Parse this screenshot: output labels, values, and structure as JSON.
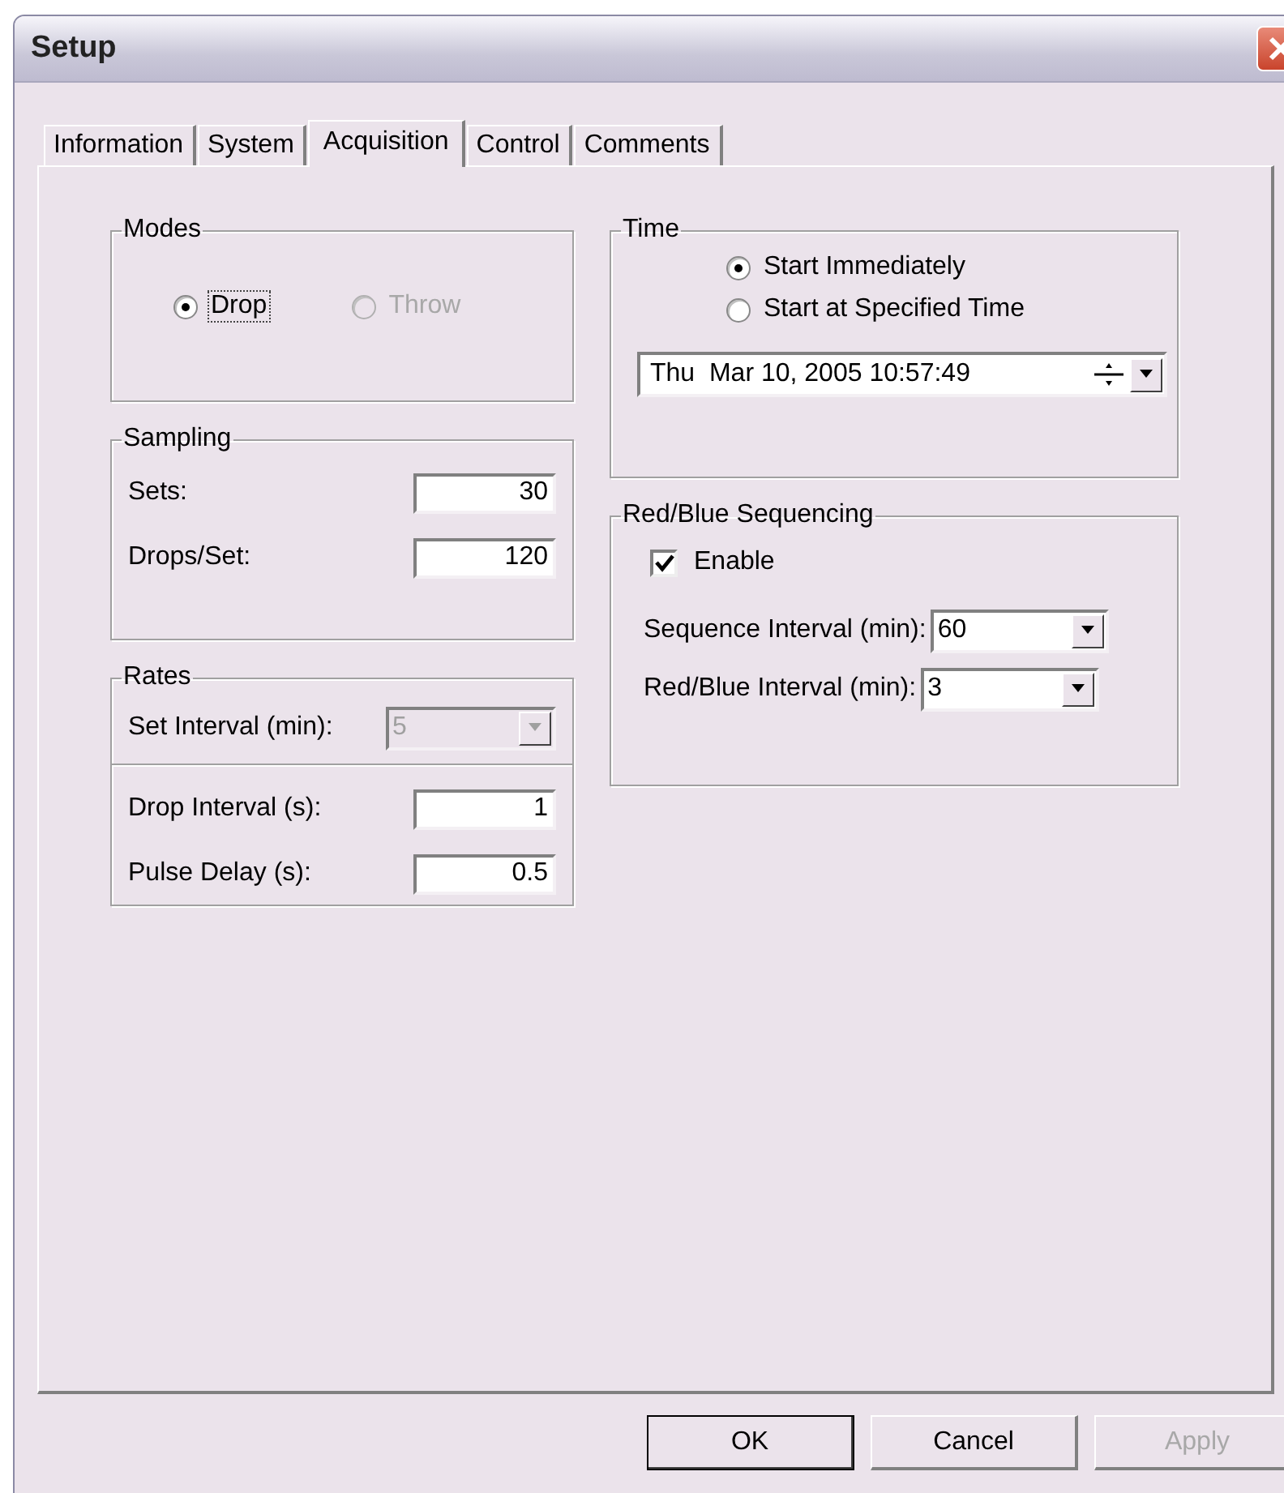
{
  "window": {
    "title": "Setup"
  },
  "tabs": [
    {
      "label": "Information",
      "selected": false
    },
    {
      "label": "System",
      "selected": false
    },
    {
      "label": "Acquisition",
      "selected": true
    },
    {
      "label": "Control",
      "selected": false
    },
    {
      "label": "Comments",
      "selected": false
    }
  ],
  "modes": {
    "title": "Modes",
    "options": [
      {
        "label": "Drop",
        "selected": true,
        "disabled": false,
        "focused": true
      },
      {
        "label": "Throw",
        "selected": false,
        "disabled": true,
        "focused": false
      }
    ]
  },
  "sampling": {
    "title": "Sampling",
    "fields": [
      {
        "label": "Sets:",
        "value": "30"
      },
      {
        "label": "Drops/Set:",
        "value": "120"
      }
    ]
  },
  "rates": {
    "title": "Rates",
    "set_interval": {
      "label": "Set Interval (min):",
      "value": "5",
      "disabled": true
    },
    "fields": [
      {
        "label": "Drop Interval (s):",
        "value": "1"
      },
      {
        "label": "Pulse Delay (s):",
        "value": "0.5"
      }
    ]
  },
  "time": {
    "title": "Time",
    "options": [
      {
        "label": "Start Immediately",
        "selected": true
      },
      {
        "label": "Start at Specified Time",
        "selected": false
      }
    ],
    "datetime": "Thu  Mar 10, 2005 10:57:49"
  },
  "sequencing": {
    "title": "Red/Blue Sequencing",
    "enable": {
      "label": "Enable",
      "checked": true
    },
    "dropdowns": [
      {
        "label": "Sequence Interval (min):",
        "value": "60",
        "disabled": false
      },
      {
        "label": "Red/Blue Interval (min):",
        "value": "3",
        "disabled": false
      }
    ]
  },
  "buttons": [
    {
      "label": "OK",
      "default": true,
      "disabled": false
    },
    {
      "label": "Cancel",
      "default": false,
      "disabled": false
    },
    {
      "label": "Apply",
      "default": false,
      "disabled": true
    }
  ]
}
